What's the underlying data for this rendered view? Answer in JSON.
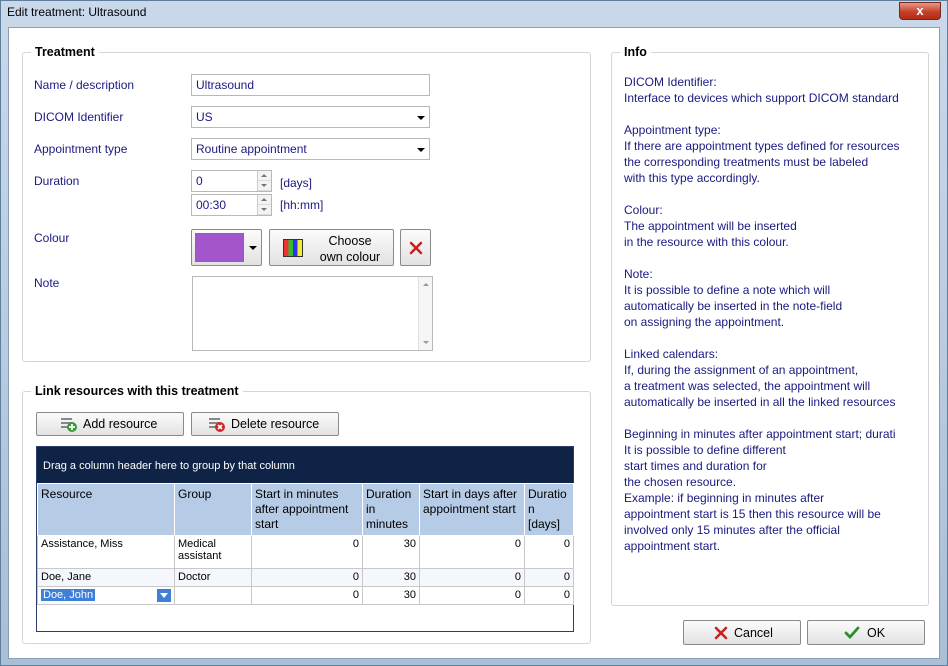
{
  "window": {
    "title": "Edit treatment: Ultrasound",
    "close_symbol": "x"
  },
  "treatment": {
    "group_title": "Treatment",
    "name_label": "Name / description",
    "name_value": "Ultrasound",
    "dicom_label": "DICOM Identifier",
    "dicom_value": "US",
    "appt_type_label": "Appointment type",
    "appt_type_value": "Routine appointment",
    "duration_label": "Duration",
    "duration_days_value": "0",
    "duration_days_unit": "[days]",
    "duration_time_value": "00:30",
    "duration_time_unit": "[hh:mm]",
    "colour_label": "Colour",
    "colour_value": "#a455cc",
    "choose_colour_line1": "Choose",
    "choose_colour_line2": "own colour",
    "note_label": "Note",
    "note_value": ""
  },
  "info": {
    "group_title": "Info",
    "text": "DICOM Identifier:\nInterface to devices which support DICOM standard\n\nAppointment type:\nIf there are appointment types defined for resources\nthe corresponding treatments must be labeled\nwith this type accordingly.\n\nColour:\nThe appointment will be inserted\nin the resource with this colour.\n\nNote:\nIt is possible to define a note which will\nautomatically be inserted in the note-field\non assigning the appointment.\n\nLinked calendars:\nIf, during the assignment of an appointment,\na treatment was selected, the appointment will\nautomatically be inserted in all the linked resources\n\nBeginning in minutes after appointment start; durati\nIt is possible to define different\nstart times and duration for\nthe chosen resource.\nExample: if beginning in minutes after\nappointment start is 15 then this resource will be\ninvolved only 15 minutes after the official\nappointment start."
  },
  "link": {
    "group_title": "Link resources with this treatment",
    "add_label": "Add resource",
    "delete_label": "Delete resource",
    "group_hint": "Drag a column header here to group by that column",
    "columns": [
      "Resource",
      "Group",
      "Start in minutes after appointment start",
      "Duration in minutes",
      "Start in days after appointment start",
      "Duratio n [days]"
    ],
    "rows": [
      {
        "resource": "Assistance, Miss",
        "group": "Medical assistant",
        "start_min": "0",
        "dur_min": "30",
        "start_days": "0",
        "dur_days": "0"
      },
      {
        "resource": "Doe, Jane",
        "group": "Doctor",
        "start_min": "0",
        "dur_min": "30",
        "start_days": "0",
        "dur_days": "0"
      },
      {
        "resource": "Doe, John",
        "group": "",
        "start_min": "0",
        "dur_min": "30",
        "start_days": "0",
        "dur_days": "0"
      }
    ]
  },
  "footer": {
    "cancel_label": "Cancel",
    "ok_label": "OK"
  },
  "colors": {
    "cancel_icon": "#cc1f1f",
    "ok_icon": "#2a8f2a",
    "delete_colour_icon": "#cc1f1f"
  }
}
